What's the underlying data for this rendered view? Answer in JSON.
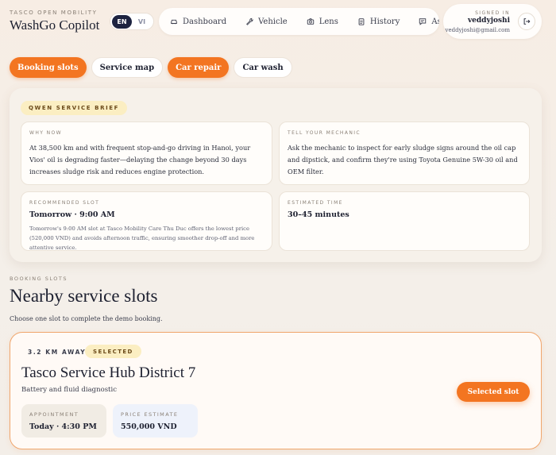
{
  "header": {
    "brand_eyebrow": "TASCO OPEN MOBILITY",
    "brand_title": "WashGo Copilot",
    "lang": [
      "EN",
      "VI"
    ],
    "nav": [
      {
        "label": "Dashboard",
        "icon": "car-icon"
      },
      {
        "label": "Vehicle",
        "icon": "wrench-icon"
      },
      {
        "label": "Lens",
        "icon": "camera-icon"
      },
      {
        "label": "History",
        "icon": "clipboard-icon"
      },
      {
        "label": "Assist",
        "icon": "chat-icon"
      }
    ],
    "account": {
      "eyebrow": "SIGNED IN",
      "name": "veddyjoshi",
      "email": "veddyjoshi@gmail.com",
      "logout_icon": "logout-icon"
    }
  },
  "tabs": [
    {
      "label": "Booking slots",
      "active": true
    },
    {
      "label": "Service map",
      "active": false
    },
    {
      "label": "Car repair",
      "active": true
    },
    {
      "label": "Car wash",
      "active": false
    }
  ],
  "brief": {
    "badge": "QWEN SERVICE BRIEF",
    "why_now": {
      "eyebrow": "WHY NOW",
      "text": "At 38,500 km and with frequent stop-and-go driving in Hanoi, your Vios' oil is degrading faster—delaying the change beyond 30 days increases sludge risk and reduces engine protection."
    },
    "mechanic": {
      "eyebrow": "TELL YOUR MECHANIC",
      "text": "Ask the mechanic to inspect for early sludge signs around the oil cap and dipstick, and confirm they're using Toyota Genuine 5W-30 oil and OEM filter."
    },
    "slot": {
      "eyebrow": "RECOMMENDED SLOT",
      "head": "Tomorrow · 9:00 AM",
      "text": "Tomorrow's 9:00 AM slot at Tasco Mobility Care Thu Duc offers the lowest price (520,000 VND) and avoids afternoon traffic, ensuring smoother drop-off and more attentive service."
    },
    "time": {
      "eyebrow": "ESTIMATED TIME",
      "head": "30–45 minutes"
    }
  },
  "section": {
    "eyebrow": "BOOKING SLOTS",
    "title": "Nearby service slots",
    "subtitle": "Choose one slot to complete the demo booking."
  },
  "slot_card": {
    "distance": "3.2 KM AWAY",
    "badge": "SELECTED",
    "title": "Tasco Service Hub District 7",
    "subtitle": "Battery and fluid diagnostic",
    "appointment_eyebrow": "APPOINTMENT",
    "appointment": "Today · 4:30 PM",
    "price_eyebrow": "PRICE ESTIMATE",
    "price": "550,000 VND",
    "button": "Selected slot"
  },
  "colors": {
    "accent": "#f37521",
    "navy": "#1d2340",
    "badge_bg": "#fbeec2"
  }
}
